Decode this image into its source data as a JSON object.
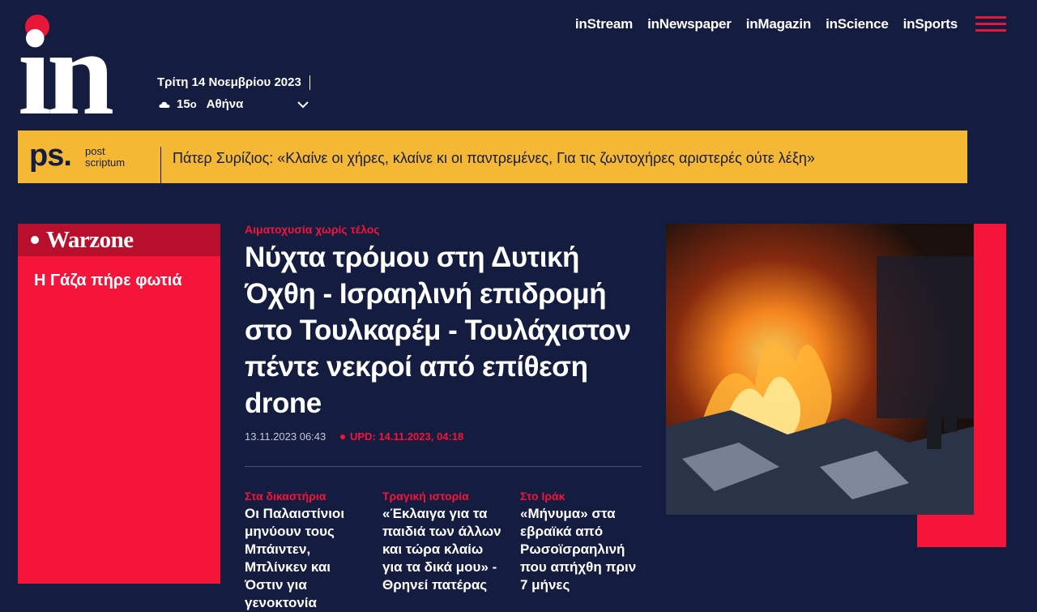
{
  "logo": {
    "text": "in"
  },
  "nav": {
    "items": [
      "inStream",
      "inNewspaper",
      "inMagazin",
      "inScience",
      "inSports"
    ]
  },
  "header": {
    "date": "Τρίτη 14 Νοεμβρίου 2023",
    "temperature": "15",
    "temp_unit": "o",
    "city": "Αθήνα"
  },
  "ps": {
    "logo": "ps.",
    "sub_line1": "post",
    "sub_line2": "scriptum",
    "headline": "Πάτερ Συρίζιος: «Κλαίνε οι χήρες, κλαίνε κι οι παντρεμένες, Για τις ζωντοχήρες αριστερές ούτε λέξη»"
  },
  "warzone": {
    "title": "Warzone",
    "story": "Η Γάζα πήρε φωτιά"
  },
  "main": {
    "kicker": "Αιματοχυσία χωρίς τέλος",
    "headline": "Νύχτα τρόμου στη Δυτική Όχθη - Ισραηλινή επιδρομή στο Τουλκαρέμ - Τουλάχιστον πέντε νεκροί από επίθεση drone",
    "date": "13.11.2023 06:43",
    "updated": "UPD: 14.11.2023, 04:18"
  },
  "sub_stories": [
    {
      "kicker": "Στα δικαστήρια",
      "title": "Οι Παλαιστίνιοι μηνύουν τους Μπάιντεν, Μπλίνκεν και Όστιν για γενοκτονία"
    },
    {
      "kicker": "Τραγική ιστορία",
      "title": "«Έκλαιγα για τα παιδιά των άλλων και τώρα κλαίω για τα δικά μου» - Θρηνεί πατέρας"
    },
    {
      "kicker": "Στο Ιράκ",
      "title": "«Μήνυμα» στα εβραϊκά από Ρωσοϊσραηλινή που απήχθη πριν 7 μήνες"
    }
  ],
  "colors": {
    "background": "#141c3f",
    "accent": "#f5143a",
    "ps_yellow": "#f5b834"
  },
  "icons": [
    "cloud-icon",
    "chevron-down-icon",
    "hamburger-menu-icon"
  ]
}
